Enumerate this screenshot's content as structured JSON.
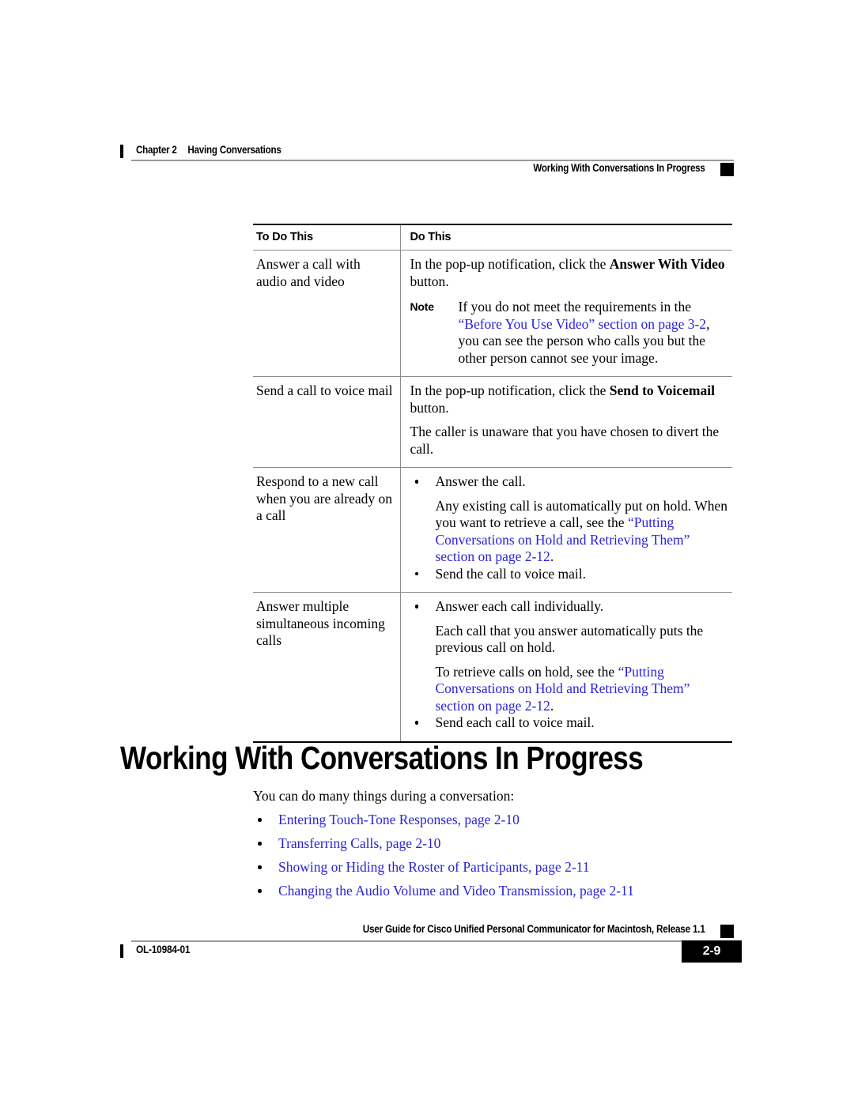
{
  "header": {
    "chapter": "Chapter 2",
    "chapter_title": "Having Conversations",
    "section": "Working With Conversations In Progress"
  },
  "table": {
    "columns": [
      "To Do This",
      "Do This"
    ],
    "rows": [
      {
        "task": "Answer a call with audio and video",
        "blocks": [
          {
            "kind": "para",
            "runs": [
              {
                "t": "In the pop-up notification, click the "
              },
              {
                "t": "Answer With Video",
                "style": "bold"
              },
              {
                "t": " button."
              }
            ]
          },
          {
            "kind": "note",
            "label": "Note",
            "runs": [
              {
                "t": "If you do not meet the requirements in the "
              },
              {
                "t": "“Before You Use Video” section on page 3-2",
                "style": "link"
              },
              {
                "t": ", you can see the person who calls you but the other person cannot see your image."
              }
            ]
          }
        ]
      },
      {
        "task": "Send a call to voice mail",
        "blocks": [
          {
            "kind": "para",
            "runs": [
              {
                "t": "In the pop-up notification, click the "
              },
              {
                "t": "Send to Voicemail",
                "style": "bold"
              },
              {
                "t": " button."
              }
            ]
          },
          {
            "kind": "para",
            "runs": [
              {
                "t": "The caller is unaware that you have chosen to divert the call."
              }
            ]
          }
        ]
      },
      {
        "task": "Respond to a new call when you are already on a call",
        "blocks": [
          {
            "kind": "bullet",
            "runs": [
              {
                "t": "Answer the call."
              }
            ]
          },
          {
            "kind": "sub",
            "runs": [
              {
                "t": "Any existing call is automatically put on hold. When you want to retrieve a call, see the "
              },
              {
                "t": "“Putting Conversations on Hold and Retrieving Them” section on page 2-12",
                "style": "link"
              },
              {
                "t": "."
              }
            ]
          },
          {
            "kind": "bullet",
            "runs": [
              {
                "t": "Send the call to voice mail."
              }
            ]
          }
        ]
      },
      {
        "task": "Answer multiple simultaneous incoming calls",
        "blocks": [
          {
            "kind": "bullet",
            "runs": [
              {
                "t": "Answer each call individually."
              }
            ]
          },
          {
            "kind": "sub",
            "runs": [
              {
                "t": "Each call that you answer automatically puts the previous call on hold."
              }
            ]
          },
          {
            "kind": "sub",
            "runs": [
              {
                "t": "To retrieve calls on hold, see the "
              },
              {
                "t": "“Putting Conversations on Hold and Retrieving Them” section on page 2-12",
                "style": "link"
              },
              {
                "t": "."
              }
            ]
          },
          {
            "kind": "bullet",
            "runs": [
              {
                "t": "Send each call to voice mail."
              }
            ]
          }
        ]
      }
    ]
  },
  "section": {
    "heading": "Working With Conversations In Progress",
    "intro": "You can do many things during a conversation:",
    "links": [
      "Entering Touch-Tone Responses, page 2-10",
      "Transferring Calls, page 2-10",
      "Showing or Hiding the Roster of Participants, page 2-11",
      "Changing the Audio Volume and Video Transmission, page 2-11"
    ]
  },
  "footer": {
    "title": "User Guide for Cisco Unified Personal Communicator for Macintosh, Release 1.1",
    "doc_id": "OL-10984-01",
    "page_number": "2-9"
  },
  "colors": {
    "link": "#2a22d8",
    "rule": "#8c8c8c",
    "text": "#000000"
  }
}
